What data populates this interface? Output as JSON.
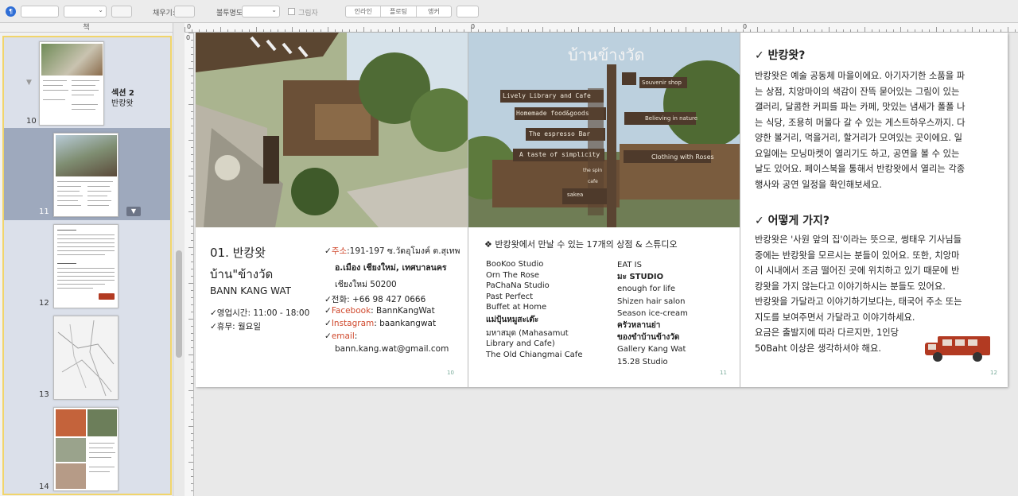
{
  "toolbar": {
    "fill_label": "채우기:",
    "opacity_label": "불투명도:",
    "shadow_label": "그림자",
    "seg": [
      "인라인",
      "플로팅",
      "앵커"
    ]
  },
  "sidebar": {
    "header": "책",
    "section_title": "섹션 2",
    "section_sub": "반캉왓",
    "pages": [
      "10",
      "11",
      "12",
      "13",
      "14"
    ]
  },
  "ruler": {
    "zero": "0"
  },
  "page10": {
    "title1": "01. 반캉왓",
    "title2": "บ้าน\"ข้างวัด",
    "title3": "BANN KANG WAT",
    "hours": "✓영업시간: 11:00 - 18:00",
    "closed": "✓휴무: 월요일",
    "addr_mark": "✓",
    "addr_label": "주소",
    "addr1": ":191-197 ซ.วัดอุโมงค์ ต.สุเทพ",
    "addr2": "อ.เมือง เชียงใหม่, เทศบาลนคร",
    "addr3": "เชียงใหม่ 50200",
    "phone": "✓전화: +66 98 427 0666",
    "fb_label": "Facebook",
    "fb_val": ": BannKangWat",
    "ig_label": "Instagram",
    "ig_val": ": baankangwat",
    "email_label": "email",
    "email_colon": ":",
    "email_val": "bann.kang.wat@gmail.com",
    "page_no": "10"
  },
  "page11": {
    "sign_title": "บ้านข้างวัด",
    "signs": [
      "Lively Library and Cafe",
      "Homemade food&goods",
      "The espresso Bar",
      "A taste of simplicity",
      "Souvenir shop",
      "Believing in nature",
      "Clothing with Roses",
      "the spin",
      "cafe",
      "sakea"
    ],
    "heading": "❖ 반캉왓에서 만날 수 있는 17개의 상점 & 스튜디오",
    "col1": [
      "BooKoo Studio",
      "Orn The Rose",
      "PaChaNa Studio",
      "Past Perfect",
      "Buffet at Home",
      "แม่ปุ้นหมูสะเต๊ะ",
      "มหาสมุด (Mahasamut",
      "Library and Cafe)",
      "The Old Chiangmai Cafe"
    ],
    "col2": [
      "EAT IS",
      "มะ STUDIO",
      "enough for life",
      "Shizen hair salon",
      "Season ice-cream",
      "ครัวหลานย่า",
      "ของขำบ้านข้างวัด",
      "Gallery Kang Wat",
      "15.28 Studio"
    ],
    "page_no": "11"
  },
  "page12": {
    "h1": "✓ 반캉왓?",
    "p1": [
      "반캉왓은 예술 공동체 마을이에요. 아기자기한 소품을 파",
      "는 상점, 치앙마이의 색감이 잔뜩 묻어있는 그림이 있는",
      "갤러리, 달콤한 커피를 파는 카페, 맛있는 냄새가 폴폴 나",
      "는 식당, 조용히 머물다 갈 수 있는 게스트하우스까지. 다",
      "양한 볼거리, 먹을거리, 할거리가 모여있는 곳이에요. 일",
      "요일에는 모닝마켓이 열리기도 하고, 공연을 볼 수 있는",
      "날도 있어요. 페이스북을 통해서 반캉왓에서 열리는 각종",
      "행사와 공연 일정을 확인해보세요."
    ],
    "h2": "✓ 어떻게 가지?",
    "p2": [
      "반캉왓은 '사원 앞의 집'이라는 뜻으로, 썽태우 기사님들",
      "중에는 반캉왓을 모르시는 분들이 있어요. 또한, 치앙마",
      "이 시내에서 조금 떨어진 곳에 위치하고 있기 때문에 반",
      "캉왓을 가지 않는다고 이야기하시는 분들도 있어요.",
      "반캉왓을 가달라고 이야기하기보다는, 태국어 주소 또는",
      "지도를 보여주면서 가달라고 이야기하세요.",
      "요금은 출발지에 따라 다르지만, 1인당",
      "50Baht 이상은 생각하셔야 해요."
    ],
    "page_no": "12"
  },
  "colors": {
    "accent_red": "#d0492d",
    "selection": "#9ea9bd",
    "sidebar_border": "#f1d56b"
  }
}
